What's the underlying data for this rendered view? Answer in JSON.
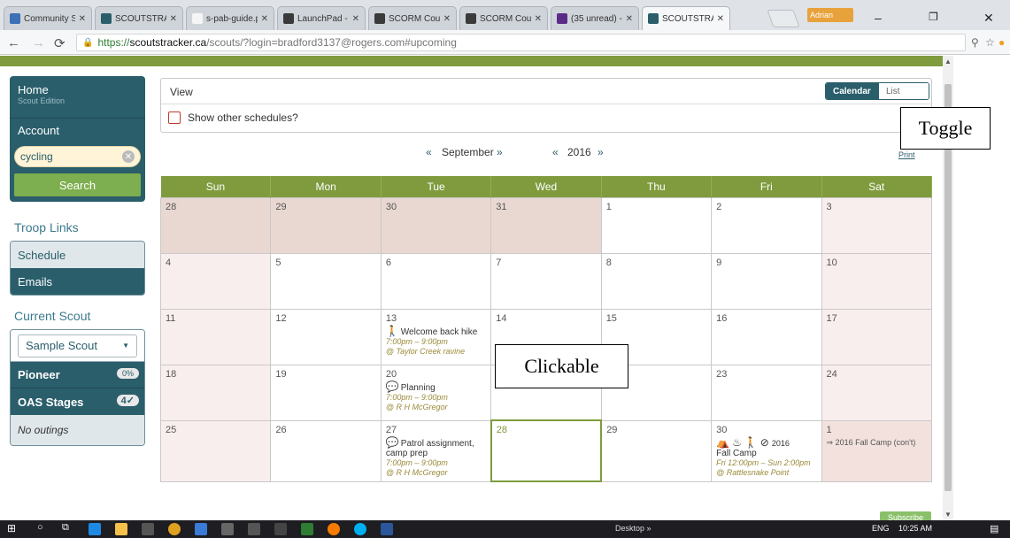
{
  "browser": {
    "tabs": [
      {
        "label": "Community S",
        "fav_color": "#3b6fb6"
      },
      {
        "label": "SCOUTSTRAC",
        "fav_color": "#2a5e6b"
      },
      {
        "label": "s-pab-guide.p",
        "fav_color": "#f5f5f5"
      },
      {
        "label": "LaunchPad - I",
        "fav_color": "#3a3a3a"
      },
      {
        "label": "SCORM Cour",
        "fav_color": "#3a3a3a"
      },
      {
        "label": "SCORM Cour",
        "fav_color": "#3a3a3a"
      },
      {
        "label": "(35 unread) -",
        "fav_color": "#5b2c87"
      },
      {
        "label": "SCOUTSTRAC",
        "fav_color": "#2a5e6b"
      }
    ],
    "user": "Adrian",
    "url_scheme": "https://",
    "url_host": "scoutstracker.ca",
    "url_path": "/scouts/?login=bradford3137@rogers.com#upcoming"
  },
  "sidebar": {
    "home": "Home",
    "edition": "Scout Edition",
    "account": "Account",
    "search_value": "cycling",
    "search_button": "Search",
    "troop_links_heading": "Troop Links",
    "schedule": "Schedule",
    "emails": "Emails",
    "current_scout_heading": "Current Scout",
    "scout_select": "Sample Scout",
    "pioneer": "Pioneer",
    "pioneer_badge": "0%",
    "oas": "OAS Stages",
    "oas_badge": "4✓",
    "no_outings": "No outings"
  },
  "view": {
    "title": "View",
    "show_other": "Show other schedules?",
    "toggle_calendar": "Calendar",
    "toggle_list": "List"
  },
  "annotations": {
    "toggle": "Toggle",
    "clickable": "Clickable"
  },
  "nav": {
    "prev": "«",
    "next": "»",
    "month": "September",
    "year": "2016",
    "print": "Print"
  },
  "calendar": {
    "days": [
      "Sun",
      "Mon",
      "Tue",
      "Wed",
      "Thu",
      "Fri",
      "Sat"
    ],
    "weeks": [
      [
        {
          "d": "28"
        },
        {
          "d": "29"
        },
        {
          "d": "30"
        },
        {
          "d": "31"
        },
        {
          "d": "1"
        },
        {
          "d": "2"
        },
        {
          "d": "3"
        }
      ],
      [
        {
          "d": "4"
        },
        {
          "d": "5"
        },
        {
          "d": "6"
        },
        {
          "d": "7"
        },
        {
          "d": "8"
        },
        {
          "d": "9"
        },
        {
          "d": "10"
        }
      ],
      [
        {
          "d": "11"
        },
        {
          "d": "12"
        },
        {
          "d": "13",
          "ev": {
            "icon": "🚶",
            "title": "Welcome back hike",
            "time": "7:00pm – 9:00pm",
            "loc": "@ Taylor Creek ravine"
          }
        },
        {
          "d": "14"
        },
        {
          "d": "15"
        },
        {
          "d": "16"
        },
        {
          "d": "17"
        }
      ],
      [
        {
          "d": "18"
        },
        {
          "d": "19"
        },
        {
          "d": "20",
          "ev": {
            "icon": "💬",
            "title": "Planning",
            "time": "7:00pm – 9:00pm",
            "loc": "@ R H McGregor"
          }
        },
        {
          "d": "21"
        },
        {
          "d": "22"
        },
        {
          "d": "23"
        },
        {
          "d": "24"
        }
      ],
      [
        {
          "d": "25"
        },
        {
          "d": "26"
        },
        {
          "d": "27",
          "ev": {
            "icon": "💬",
            "title": "Patrol assignment, camp prep",
            "time": "7:00pm – 9:00pm",
            "loc": "@ R H McGregor"
          }
        },
        {
          "d": "28"
        },
        {
          "d": "29"
        },
        {
          "d": "30",
          "camp": {
            "year": "2016",
            "title": "Fall Camp",
            "time": "Fri 12:00pm – Sun 2:00pm",
            "loc": "@ Rattlesnake Point"
          }
        },
        {
          "d": "1",
          "cont": "⇒ 2016 Fall Camp (con't)"
        }
      ]
    ]
  },
  "subscribe": "Subscribe",
  "taskbar": {
    "desktop": "Desktop",
    "lang": "ENG",
    "time": "10:25 AM"
  }
}
